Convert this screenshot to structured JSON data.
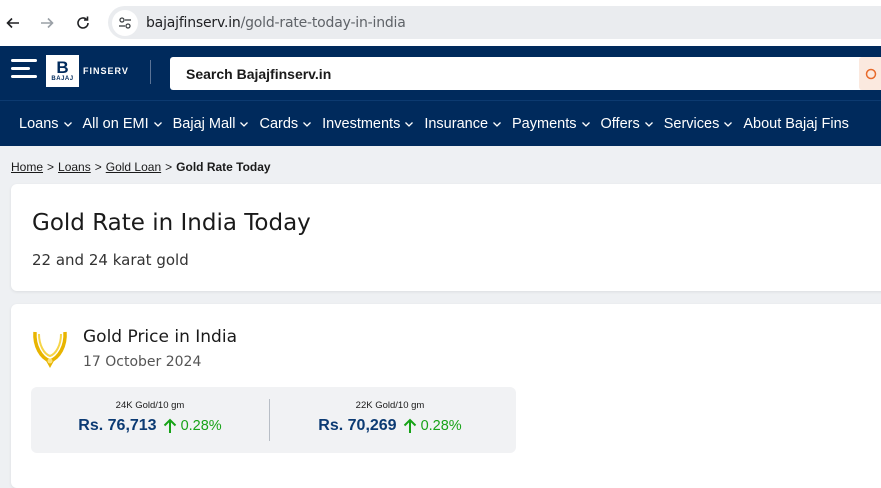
{
  "browser": {
    "url_domain": "bajajfinserv.in",
    "url_path": "/gold-rate-today-in-india"
  },
  "header": {
    "logo_letter": "B",
    "logo_small": "BAJAJ",
    "logo_brand": "FINSERV",
    "search_placeholder": "Search Bajajfinserv.in"
  },
  "menu": {
    "items": [
      {
        "label": "Loans"
      },
      {
        "label": "All on EMI"
      },
      {
        "label": "Bajaj Mall"
      },
      {
        "label": "Cards"
      },
      {
        "label": "Investments"
      },
      {
        "label": "Insurance"
      },
      {
        "label": "Payments"
      },
      {
        "label": "Offers"
      },
      {
        "label": "Services"
      },
      {
        "label": "About Bajaj Fins"
      }
    ]
  },
  "breadcrumb": {
    "home": "Home",
    "loans": "Loans",
    "gold_loan": "Gold Loan",
    "current": "Gold Rate Today",
    "separator": ">"
  },
  "hero": {
    "title": "Gold Rate in India Today",
    "subtitle": "22 and 24 karat gold"
  },
  "price": {
    "title": "Gold Price in India",
    "date": "17 October 2024",
    "rates": [
      {
        "label": "24K Gold/10 gm",
        "value": "Rs. 76,713",
        "change": "0.28%",
        "direction": "up"
      },
      {
        "label": "22K Gold/10 gm",
        "value": "Rs. 70,269",
        "change": "0.28%",
        "direction": "up"
      }
    ]
  },
  "colors": {
    "navy": "#002a5c",
    "value_blue": "#0b3a73",
    "up_green": "#17a317",
    "gold": "#e8b400"
  }
}
